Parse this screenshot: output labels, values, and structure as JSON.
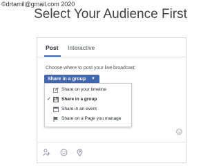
{
  "watermark": "©drtamil@gmail.com 2020",
  "slide": {
    "title": "Select Your Audience First"
  },
  "tabs": [
    {
      "label": "Post",
      "active": true
    },
    {
      "label": "Interactive",
      "active": false
    }
  ],
  "composer": {
    "prompt": "Choose where to post your live broadcast:",
    "share_button_label": "Share in a group",
    "share_button_caret": "▼"
  },
  "share_menu": {
    "items": [
      {
        "label": "Share on your timeline",
        "icon": "edit-icon",
        "selected": false
      },
      {
        "label": "Share in a group",
        "icon": "group-icon",
        "selected": true
      },
      {
        "label": "Share in an event",
        "icon": "calendar-icon",
        "selected": false
      },
      {
        "label": "Share on a Page you manage",
        "icon": "flag-icon",
        "selected": false
      }
    ],
    "check_mark": "✓"
  },
  "bottom_icons": [
    "tag-people-icon",
    "feeling-emoji-icon",
    "location-pin-icon"
  ],
  "colors": {
    "accent": "#4267b2",
    "text": "#1d2129",
    "muted": "#4b4f56"
  }
}
